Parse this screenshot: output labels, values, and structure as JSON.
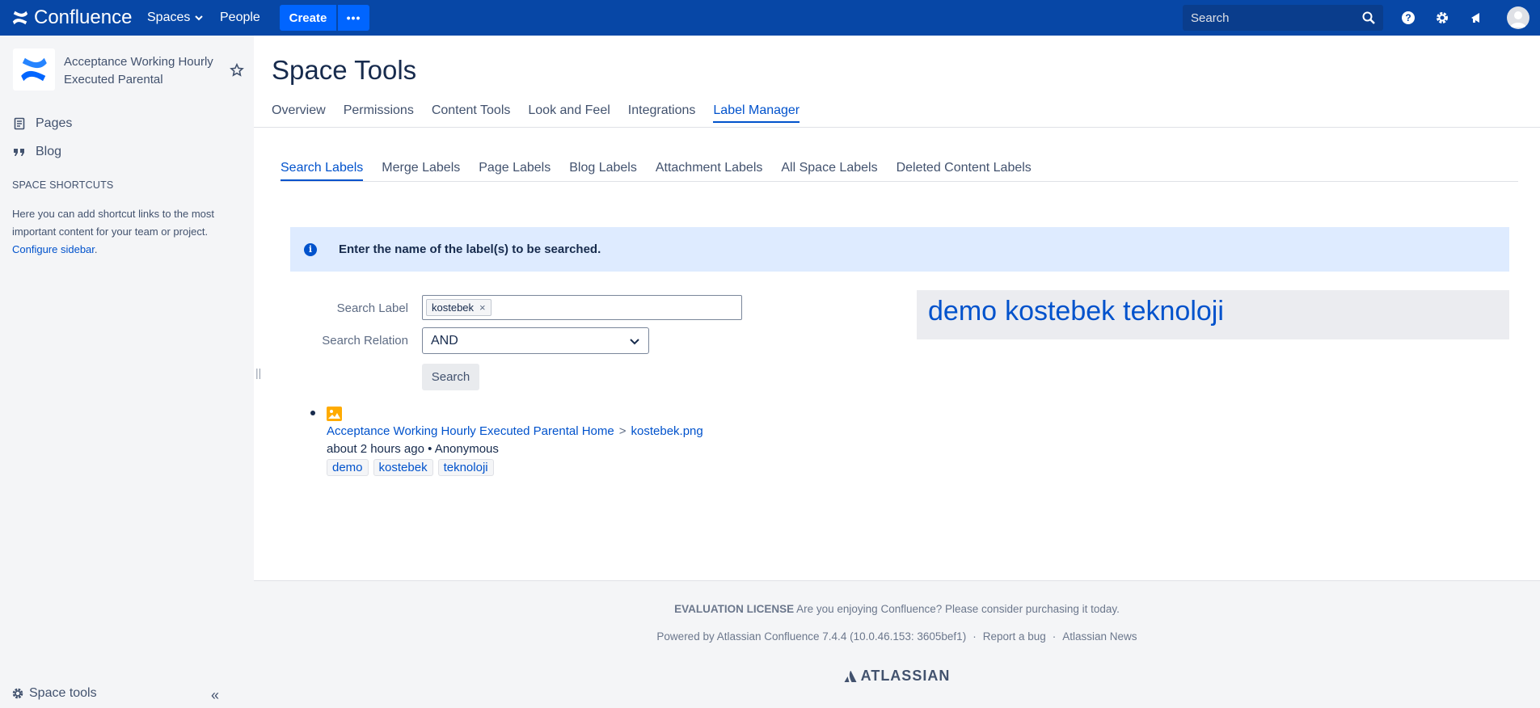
{
  "topbar": {
    "app_name": "Confluence",
    "spaces_label": "Spaces",
    "people_label": "People",
    "create_label": "Create",
    "more_label": "•••",
    "search_placeholder": "Search"
  },
  "sidebar": {
    "space_name": "Acceptance Working Hourly Executed Parental",
    "items": [
      {
        "label": "Pages",
        "icon": "pages-icon"
      },
      {
        "label": "Blog",
        "icon": "blog-icon"
      }
    ],
    "shortcuts_title": "SPACE SHORTCUTS",
    "shortcuts_text": "Here you can add shortcut links to the most important content for your team or project. ",
    "configure_link": "Configure sidebar",
    "configure_suffix": ".",
    "space_tools_label": "Space tools"
  },
  "main": {
    "title": "Space Tools",
    "tabs": [
      "Overview",
      "Permissions",
      "Content Tools",
      "Look and Feel",
      "Integrations",
      "Label Manager"
    ],
    "active_tab": "Label Manager",
    "subtabs": [
      "Search Labels",
      "Merge Labels",
      "Page Labels",
      "Blog Labels",
      "Attachment Labels",
      "All Space Labels",
      "Deleted Content Labels"
    ],
    "active_subtab": "Search Labels",
    "info_message": "Enter the name of the label(s) to be searched.",
    "form": {
      "search_label_text": "Search Label",
      "label_chip": "kostebek",
      "search_relation_text": "Search Relation",
      "relation_value": "AND",
      "search_button": "Search"
    },
    "label_cloud": [
      "demo",
      "kostebek",
      "teknoloji"
    ],
    "result": {
      "parent": "Acceptance Working Hourly Executed Parental Home",
      "separator": ">",
      "file": "kostebek.png",
      "meta": "about 2 hours ago • Anonymous",
      "labels": [
        "demo",
        "kostebek",
        "teknoloji"
      ]
    }
  },
  "footer": {
    "license_bold": "EVALUATION LICENSE",
    "license_text": " Are you enjoying Confluence? Please consider purchasing it today.",
    "powered_by": "Powered by Atlassian Confluence 7.4.4 (10.0.46.153: 3605bef1)",
    "report_bug": "Report a bug",
    "news": "Atlassian News",
    "brand": "ATLASSIAN"
  },
  "colors": {
    "topbar": "#0747a6",
    "create_button": "#0065ff",
    "link": "#0052cc",
    "info_bg": "#deebff"
  }
}
